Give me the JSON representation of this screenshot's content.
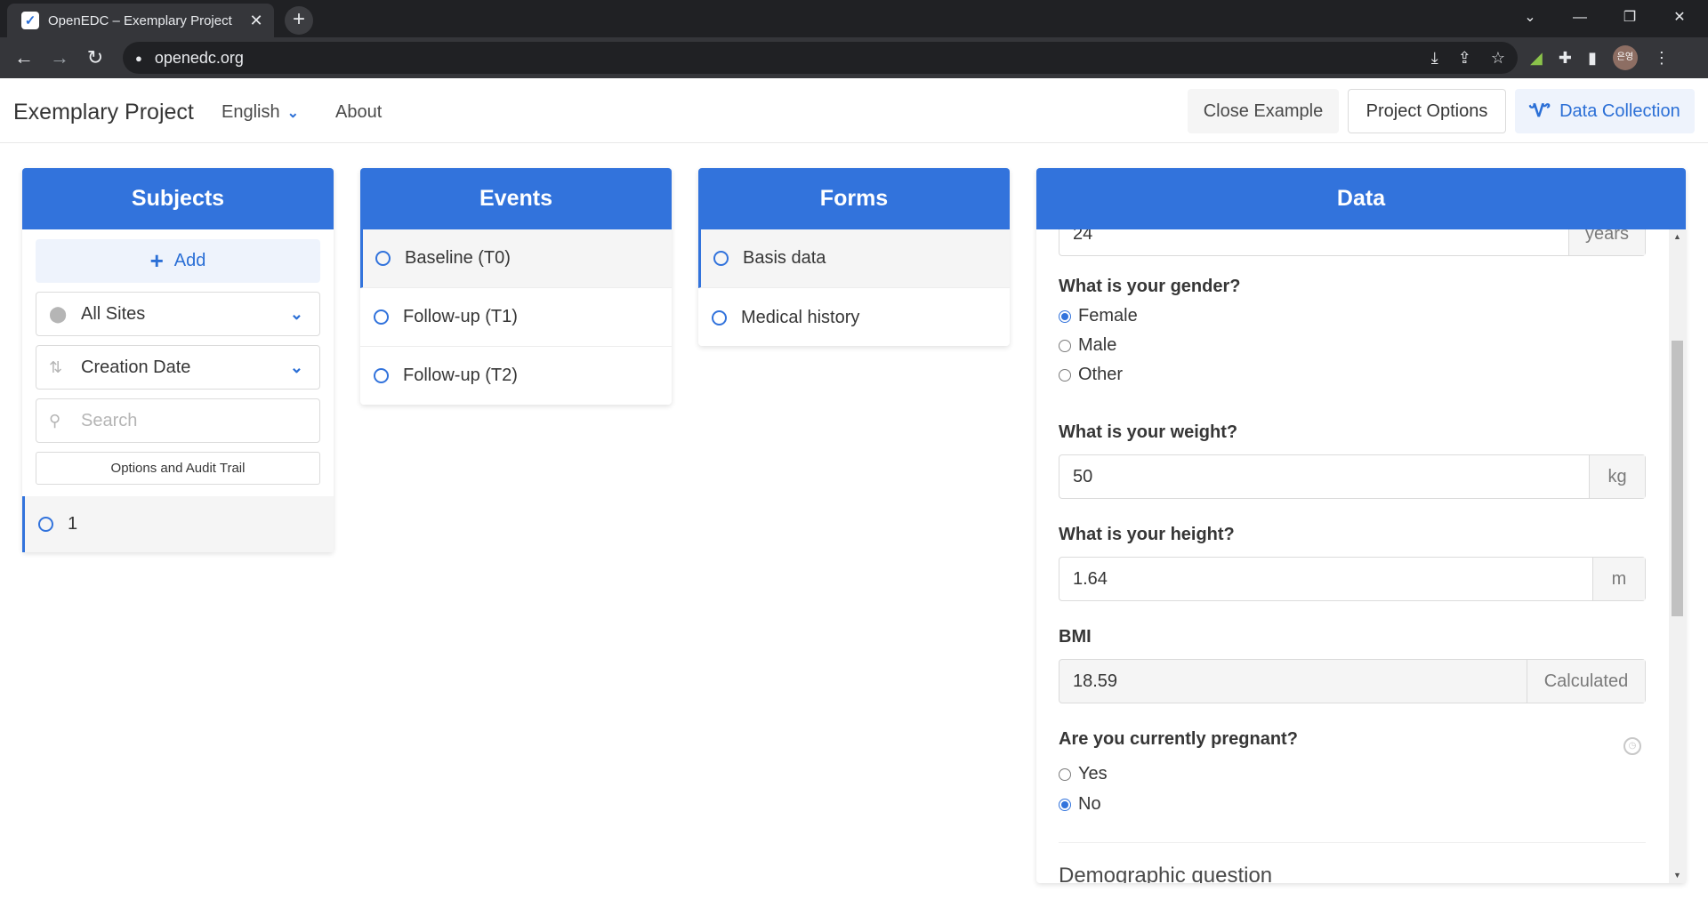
{
  "browser": {
    "tab_title": "OpenEDC – Exemplary Project",
    "url": "openedc.org",
    "profile_initials": "은영"
  },
  "header": {
    "project_title": "Exemplary Project",
    "language": "English",
    "about": "About",
    "close_example": "Close Example",
    "project_options": "Project Options",
    "data_collection": "Data Collection"
  },
  "subjects": {
    "title": "Subjects",
    "add_label": "Add",
    "site_select": "All Sites",
    "sort_select": "Creation Date",
    "search_placeholder": "Search",
    "audit_button": "Options and Audit Trail",
    "items": [
      {
        "label": "1"
      }
    ]
  },
  "events": {
    "title": "Events",
    "items": [
      {
        "label": "Baseline (T0)"
      },
      {
        "label": "Follow-up (T1)"
      },
      {
        "label": "Follow-up (T2)"
      }
    ]
  },
  "forms": {
    "title": "Forms",
    "items": [
      {
        "label": "Basis data"
      },
      {
        "label": "Medical history"
      }
    ]
  },
  "data": {
    "title": "Data",
    "age": {
      "value": "24",
      "unit": "years"
    },
    "gender": {
      "question": "What is your gender?",
      "options": [
        "Female",
        "Male",
        "Other"
      ],
      "selected": "Female"
    },
    "weight": {
      "question": "What is your weight?",
      "value": "50",
      "unit": "kg"
    },
    "height": {
      "question": "What is your height?",
      "value": "1.64",
      "unit": "m"
    },
    "bmi": {
      "question": "BMI",
      "value": "18.59",
      "unit": "Calculated"
    },
    "pregnant": {
      "question": "Are you currently pregnant?",
      "options": [
        "Yes",
        "No"
      ],
      "selected": "No"
    },
    "next_section": "Demographic question"
  },
  "colors": {
    "accent": "#3273dc",
    "accent_light": "#eef3fc"
  }
}
